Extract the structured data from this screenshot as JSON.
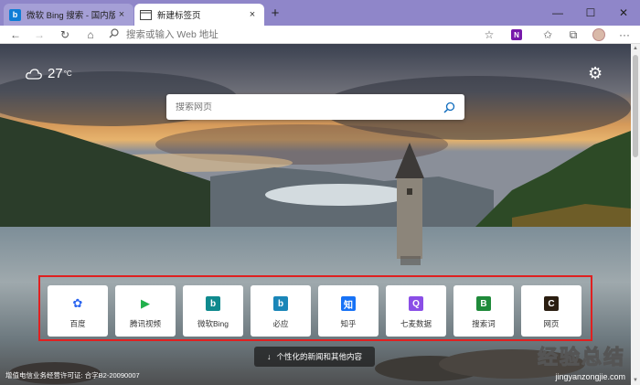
{
  "tabs": [
    {
      "title": "微软 Bing 搜索 - 国内版",
      "favicon": "bing-favicon",
      "favicon_color": "#0f7dd6",
      "favicon_glyph": "b",
      "active": false
    },
    {
      "title": "新建标签页",
      "favicon": "new-tab-favicon",
      "active": true
    }
  ],
  "tab_close": "×",
  "new_tab": "+",
  "window_controls": {
    "minimize": "—",
    "maximize": "☐",
    "close": "✕"
  },
  "toolbar": {
    "back": "←",
    "forward": "→",
    "refresh": "↻",
    "home": "⌂",
    "address_placeholder": "搜索或输入 Web 地址"
  },
  "weather": {
    "temperature": "27",
    "unit": "°C"
  },
  "search": {
    "placeholder": "搜索网页"
  },
  "quick_links": [
    {
      "label": "百度",
      "icon": "baidu-icon",
      "color": "#2b65f0",
      "glyph": "✿"
    },
    {
      "label": "腾讯视频",
      "icon": "tencent-video-icon",
      "color": "#21b04b",
      "glyph": "▶"
    },
    {
      "label": "微软Bing",
      "icon": "bing-icon",
      "color": "#0f8a8e",
      "glyph": "b"
    },
    {
      "label": "必应",
      "icon": "bing-icon",
      "color": "#1a86b8",
      "glyph": "b"
    },
    {
      "label": "知乎",
      "icon": "zhihu-icon",
      "color": "#1772f6",
      "glyph": "知"
    },
    {
      "label": "七麦数据",
      "icon": "qimai-icon",
      "color": "#8a4ee6",
      "glyph": "Q"
    },
    {
      "label": "搜索词",
      "icon": "search-term-icon",
      "color": "#1f8a3a",
      "glyph": "B"
    },
    {
      "label": "网页",
      "icon": "webpage-icon",
      "color": "#2a1d10",
      "glyph": "C"
    }
  ],
  "news_button": "个性化的新闻和其他内容",
  "icp": "增值电信业务经营许可证: 合字B2-20090007",
  "watermark": {
    "big": "经验总结",
    "small": "jingyanzongjie.com"
  },
  "colors": {
    "tabbar": "#8f86c9",
    "highlight_border": "#e02020"
  }
}
